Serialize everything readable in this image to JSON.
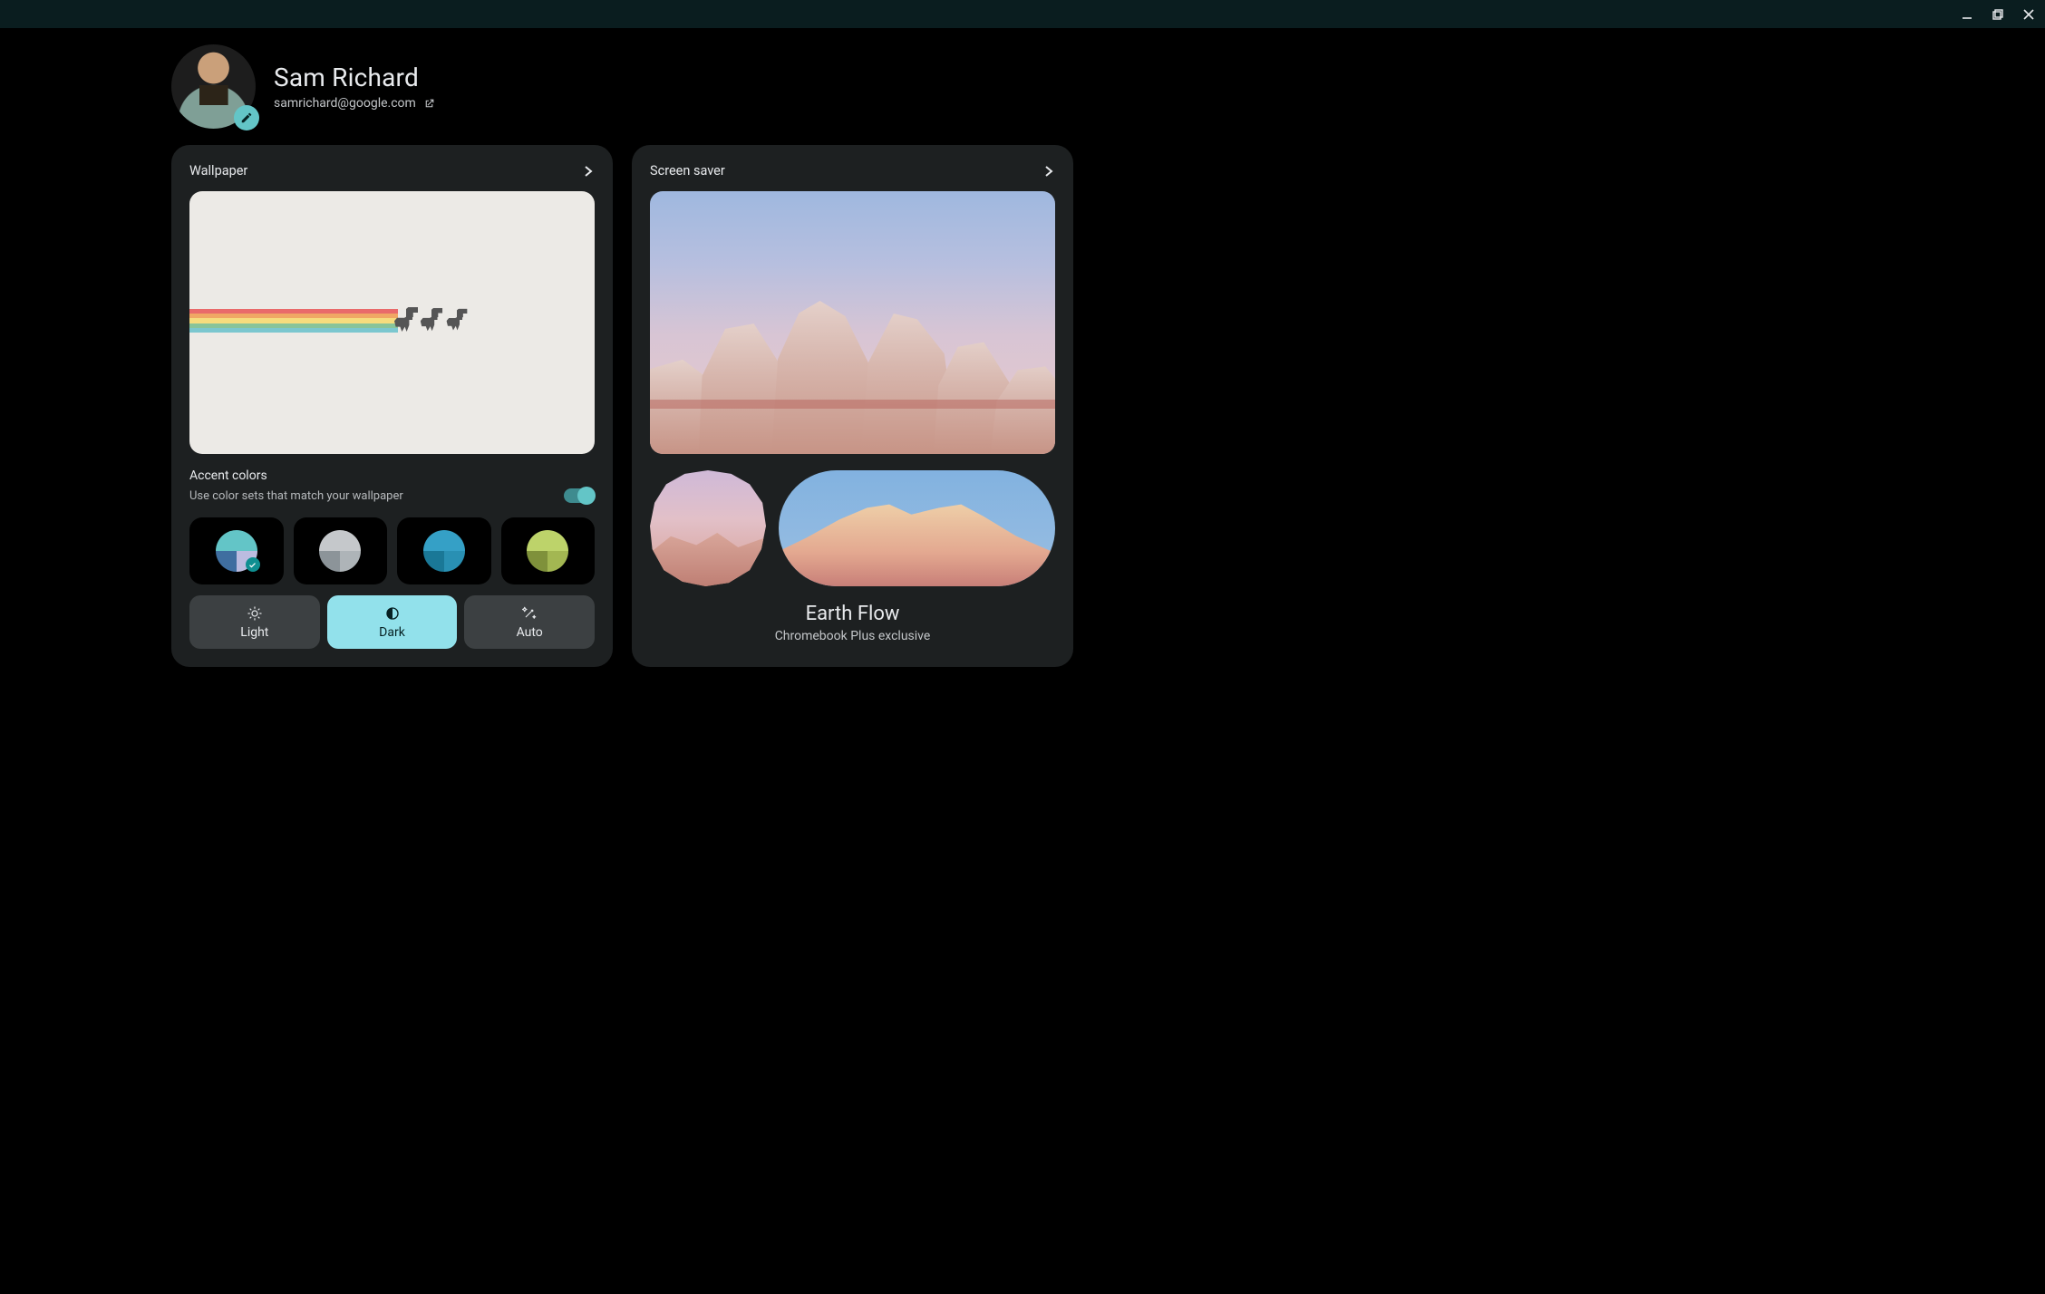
{
  "window": {
    "minimize_icon": "minimize",
    "restore_icon": "restore",
    "close_icon": "close"
  },
  "profile": {
    "name": "Sam Richard",
    "email": "samrichard@google.com",
    "edit_icon": "pencil",
    "external_icon": "open-in-new"
  },
  "wallpaper": {
    "title": "Wallpaper",
    "accent": {
      "subtitle": "Accent colors",
      "description": "Use color sets that match your wallpaper",
      "toggle_on": true,
      "swatches": [
        {
          "top": "#63c5c7",
          "left": "#3f6ea0",
          "right": "#bcbce0",
          "selected": true
        },
        {
          "top": "#c5c8cb",
          "left": "#8c9499",
          "right": "#aeb4b8",
          "selected": false
        },
        {
          "top": "#35a0c6",
          "left": "#1a7897",
          "right": "#2990b3",
          "selected": false
        },
        {
          "top": "#bdd36a",
          "left": "#7f913b",
          "right": "#a3b752",
          "selected": false
        }
      ]
    },
    "theme": {
      "light": "Light",
      "dark": "Dark",
      "auto": "Auto",
      "active": "dark"
    }
  },
  "screensaver": {
    "title": "Screen saver",
    "caption_title": "Earth Flow",
    "caption_sub": "Chromebook Plus exclusive"
  }
}
